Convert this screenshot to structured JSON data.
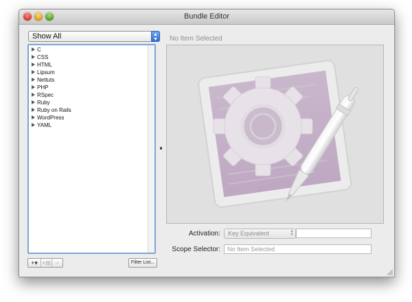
{
  "window": {
    "title": "Bundle Editor"
  },
  "filter_popup": {
    "selected": "Show All"
  },
  "bundles": [
    {
      "label": "C"
    },
    {
      "label": "CSS"
    },
    {
      "label": "HTML"
    },
    {
      "label": "Lipsum"
    },
    {
      "label": "Nettuts"
    },
    {
      "label": "PHP"
    },
    {
      "label": "RSpec"
    },
    {
      "label": "Ruby"
    },
    {
      "label": "Ruby on Rails"
    },
    {
      "label": "WordPress"
    },
    {
      "label": "YAML"
    }
  ],
  "list_buttons": {
    "add": "+▾",
    "add_group": "+⊞",
    "remove": "−",
    "filter": "Filter List..."
  },
  "detail": {
    "title": "No Item Selected",
    "activation_label": "Activation:",
    "activation_value": "Key Equivalent",
    "activation_input": "",
    "scope_label": "Scope Selector:",
    "scope_value": "No Item Selected"
  },
  "colors": {
    "accent": "#2f6fd3",
    "list_focus": "#7da4d8",
    "window_bg": "#ececec"
  },
  "icons": {
    "preview": "bundle-editor-gear-pen-icon",
    "close": "close-icon",
    "minimize": "minimize-icon",
    "zoom": "zoom-icon"
  }
}
